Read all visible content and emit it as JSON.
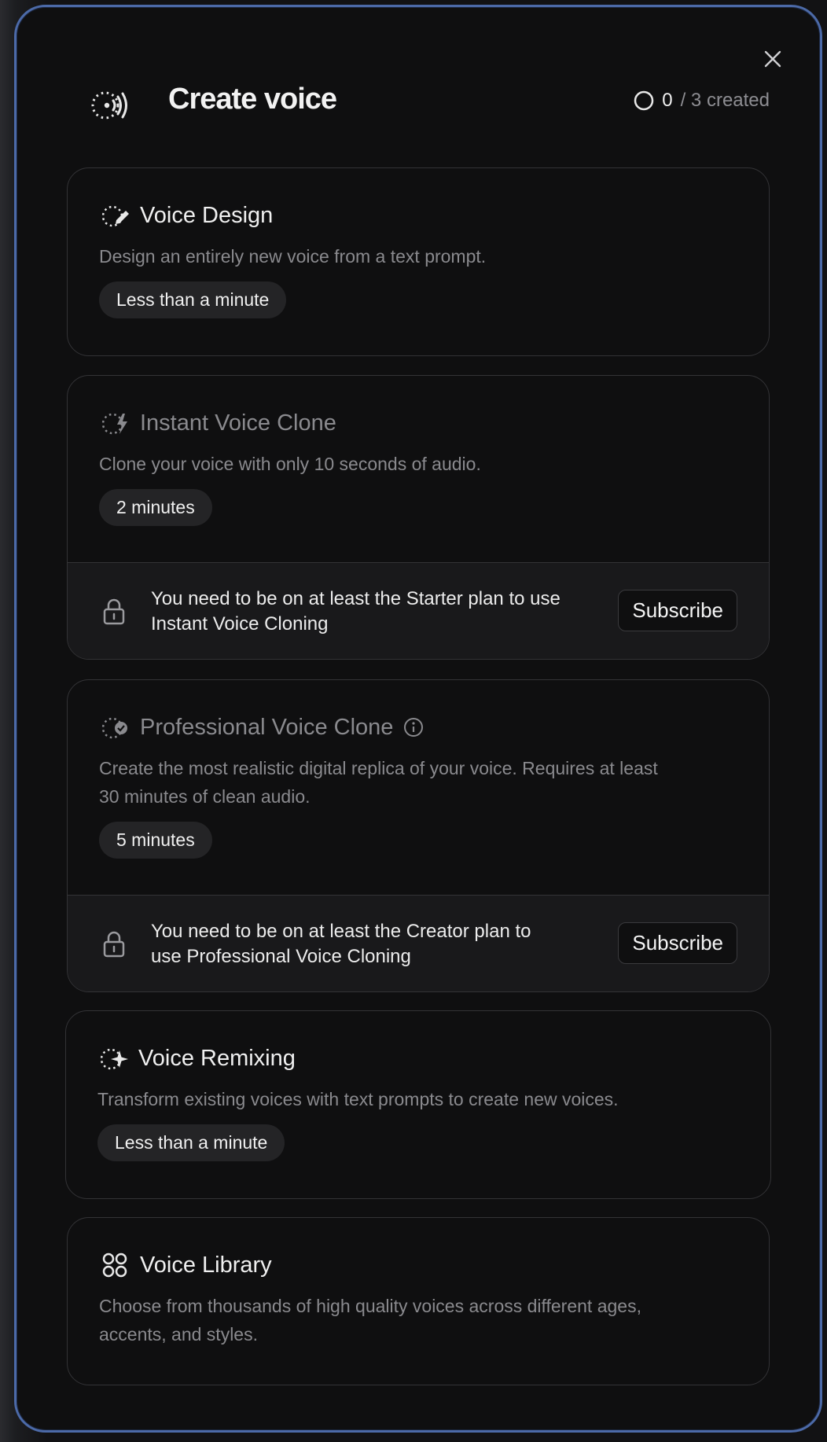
{
  "header": {
    "title": "Create voice",
    "counter_value": "0",
    "counter_suffix": "/ 3 created"
  },
  "cards": [
    {
      "title": "Voice Design",
      "description": "Design an entirely new voice from a text prompt.",
      "duration": "Less than a minute",
      "icon": "voice-design-icon"
    },
    {
      "title": "Instant Voice Clone",
      "description": "Clone your voice with only 10 seconds of audio.",
      "duration": "2 minutes",
      "icon": "instant-clone-icon",
      "lock_message_line1": "You need to be on at least the Starter plan to use",
      "lock_message_line2": "Instant Voice Cloning",
      "button": "Subscribe"
    },
    {
      "title": "Professional Voice Clone",
      "description_line1": "Create the most realistic digital replica of your voice. Requires at least",
      "description_line2": "30 minutes of clean audio.",
      "duration": "5 minutes",
      "icon": "professional-clone-icon",
      "lock_message_line1": "You need to be on at least the Creator plan to",
      "lock_message_line2": "use Professional Voice Cloning",
      "button": "Subscribe"
    },
    {
      "title": "Voice Remixing",
      "description": "Transform existing voices with text prompts to create new voices.",
      "duration": "Less than a minute",
      "icon": "voice-remixing-icon"
    },
    {
      "title": "Voice Library",
      "description_line1": "Choose from thousands of high quality voices across different ages,",
      "description_line2": "accents, and styles.",
      "icon": "voice-library-icon"
    }
  ],
  "colors": {
    "modal_border": "#4c6aa8",
    "modal_bg": "#0f0f10",
    "card_border": "#333336",
    "pill_bg": "#242426"
  }
}
